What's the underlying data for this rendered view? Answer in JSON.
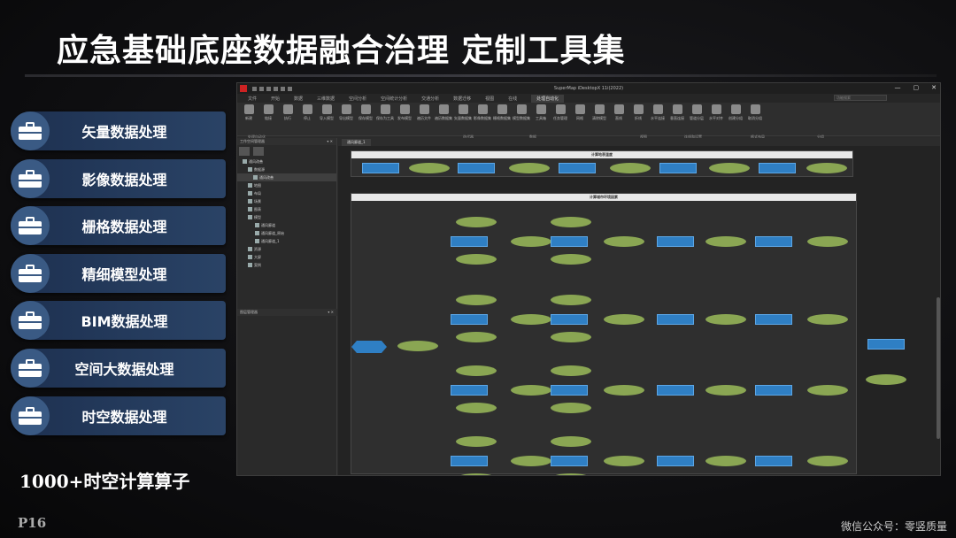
{
  "slide": {
    "title": "应急基础底座数据融合治理 定制工具集",
    "ops_count": "1000+时空计算算子",
    "page_no": "P16",
    "watermark": "微信公众号：零竖质量"
  },
  "side_buttons": [
    {
      "label": "矢量数据处理",
      "icon": "briefcase-icon"
    },
    {
      "label": "影像数据处理",
      "icon": "briefcase-icon"
    },
    {
      "label": "栅格数据处理",
      "icon": "briefcase-icon"
    },
    {
      "label": "精细模型处理",
      "icon": "briefcase-icon"
    },
    {
      "label": "BIM数据处理",
      "icon": "briefcase-icon"
    },
    {
      "label": "空间大数据处理",
      "icon": "briefcase-icon"
    },
    {
      "label": "时空数据处理",
      "icon": "briefcase-icon"
    }
  ],
  "app": {
    "window_title": "SuperMap iDesktopX 11i(2022)",
    "menu": [
      "文件",
      "开始",
      "数据",
      "三维数据",
      "空间分析",
      "空间统计分析",
      "交通分析",
      "数据迁移",
      "视图",
      "在线",
      "处理自动化"
    ],
    "active_menu": "处理自动化",
    "search_placeholder": "功能搜索",
    "ribbon_buttons": [
      "新建",
      "链接",
      "执行",
      "停止",
      "导入模型",
      "导出模型",
      "保存模型",
      "保存为工具",
      "发布模型",
      "遍历文件",
      "遍历数据集",
      "矢量数据集",
      "影像数据集",
      "栅格数据集",
      "模型数据集",
      "工具箱",
      "任务管理",
      "网格",
      "清除模型",
      "直线",
      "折线",
      "水平连接",
      "垂直连接",
      "管道分层",
      "水平对齐",
      "创建分组",
      "取消分组"
    ],
    "ribbon_groups": [
      "处理自动化",
      "迭代器",
      "数据",
      "视图",
      "连线和设置",
      "格式布局",
      "分组"
    ],
    "left_panel_title": "工作空间管理器",
    "tree": [
      {
        "label": "通风改善",
        "sel": false
      },
      {
        "label": "数据源",
        "sel": false
      },
      {
        "label": "通风改善",
        "sel": true
      },
      {
        "label": "地图",
        "sel": false
      },
      {
        "label": "布局",
        "sel": false
      },
      {
        "label": "场景",
        "sel": false
      },
      {
        "label": "图表",
        "sel": false
      },
      {
        "label": "模型",
        "sel": false
      },
      {
        "label": "通风廊道",
        "sel": false
      },
      {
        "label": "通风廊道_原始",
        "sel": false
      },
      {
        "label": "通风廊道_1",
        "sel": false
      },
      {
        "label": "资源",
        "sel": false
      },
      {
        "label": "大屏",
        "sel": false
      },
      {
        "label": "案例",
        "sel": false
      }
    ],
    "bottom_panel_title": "图层管理器",
    "doc_tab": "通风廊道_1",
    "flow_panel_1_title": "计算地表温度",
    "flow_panel_2_title": "计算城市环境因素"
  }
}
